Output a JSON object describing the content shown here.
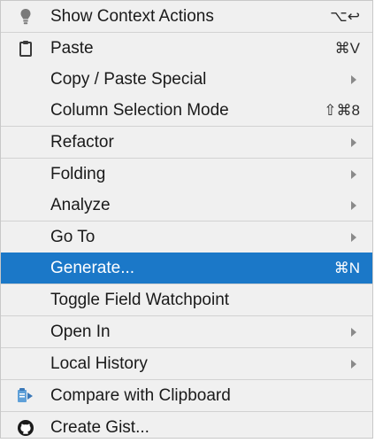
{
  "menu": {
    "items": [
      {
        "label": "Show Context Actions",
        "shortcut": "⌥↩",
        "icon": "lightbulb-icon"
      },
      {
        "label": "Paste",
        "shortcut": "⌘V",
        "icon": "clipboard-icon"
      },
      {
        "label": "Copy / Paste Special",
        "submenu": true
      },
      {
        "label": "Column Selection Mode",
        "shortcut": "⇧⌘8"
      },
      {
        "label": "Refactor",
        "submenu": true
      },
      {
        "label": "Folding",
        "submenu": true
      },
      {
        "label": "Analyze",
        "submenu": true
      },
      {
        "label": "Go To",
        "submenu": true
      },
      {
        "label": "Generate...",
        "shortcut": "⌘N",
        "selected": true
      },
      {
        "label": "Toggle Field Watchpoint"
      },
      {
        "label": "Open In",
        "submenu": true
      },
      {
        "label": "Local History",
        "submenu": true
      },
      {
        "label": "Compare with Clipboard",
        "icon": "compare-clipboard-icon"
      },
      {
        "label": "Create Gist...",
        "icon": "github-icon"
      }
    ]
  },
  "colors": {
    "selection": "#1b78c8",
    "menu_background": "#f0f0f0",
    "separator": "#d2d2d2"
  }
}
